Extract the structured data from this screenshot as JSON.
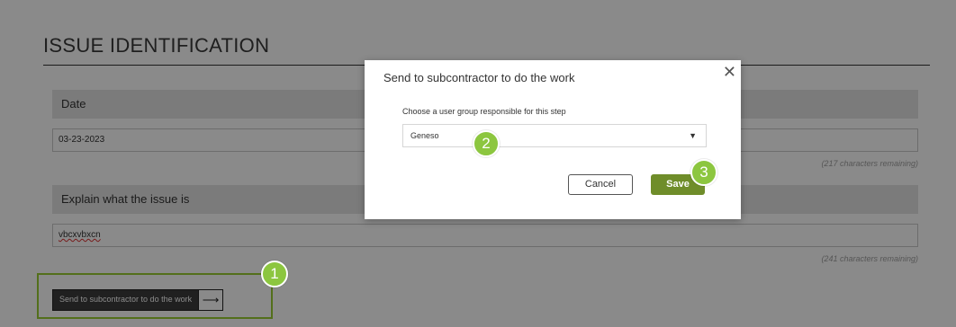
{
  "section": {
    "title": "ISSUE IDENTIFICATION"
  },
  "date": {
    "label": "Date",
    "value": "03-23-2023",
    "remaining": "(217 characters remaining)"
  },
  "explain": {
    "label": "Explain what the issue is",
    "value": "vbcxvbxcn",
    "remaining": "(241 characters remaining)"
  },
  "send_button": {
    "label": "Send to subcontractor to do the work",
    "icon": "arrow-right-icon"
  },
  "modal": {
    "title": "Send to subcontractor to do the work",
    "close_icon": "close-icon",
    "prompt": "Choose a user group responsible for this step",
    "select_value": "Geneso",
    "cancel_label": "Cancel",
    "save_label": "Save"
  },
  "badges": {
    "one": "1",
    "two": "2",
    "three": "3"
  },
  "colors": {
    "accent_green": "#8cc63f",
    "save_green": "#6f8d2a",
    "dark_button": "#3b3b3b"
  }
}
